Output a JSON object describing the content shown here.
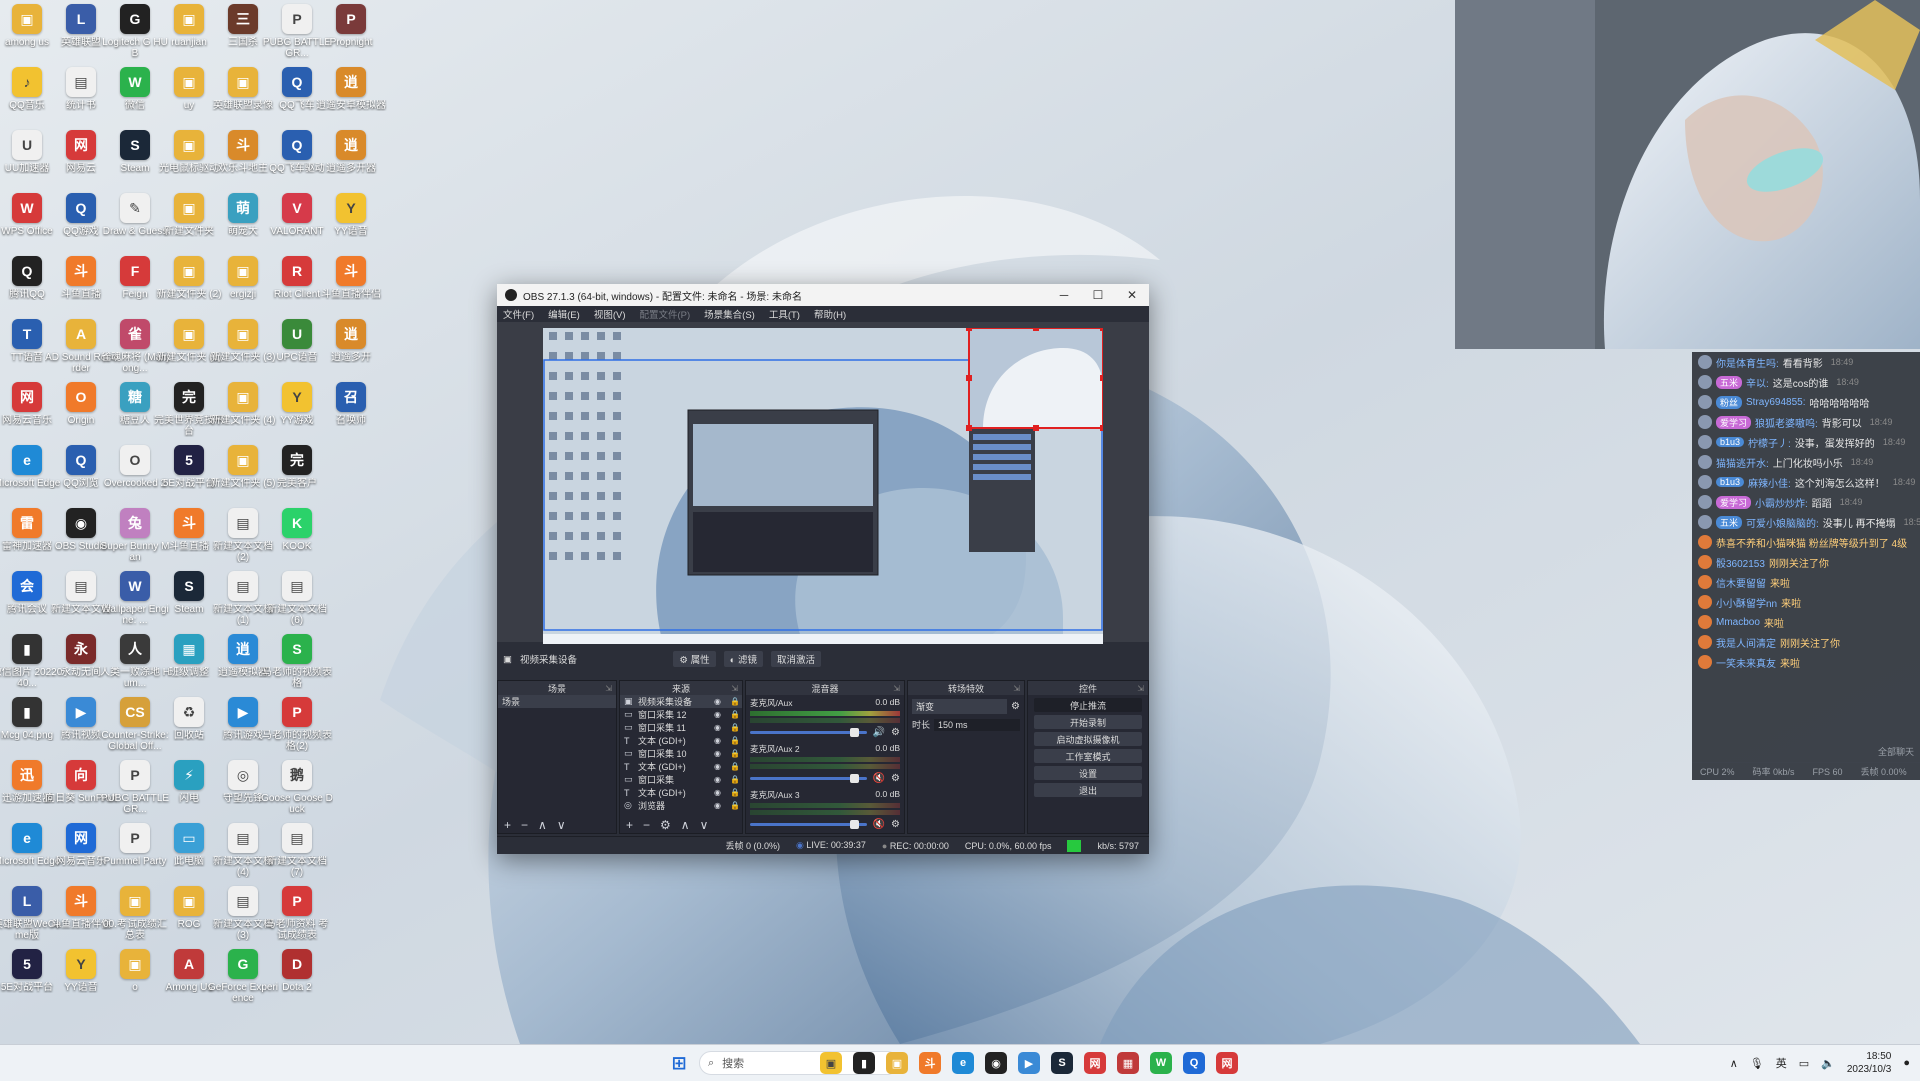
{
  "desktop": {
    "icons": [
      {
        "label": "among us",
        "color": "#e8b33a",
        "glyph": "▣"
      },
      {
        "label": "英雄联盟",
        "color": "#3a5da8",
        "glyph": "L"
      },
      {
        "label": "Logitech G HUB",
        "color": "#222222",
        "glyph": "G"
      },
      {
        "label": "ruanjian",
        "color": "#e8b33a",
        "glyph": "▣"
      },
      {
        "label": "三国杀",
        "color": "#6b3a2a",
        "glyph": "三"
      },
      {
        "label": "PUBG BATTLEGR...",
        "color": "#f0f0f0",
        "glyph": "P"
      },
      {
        "label": "Propnight",
        "color": "#7a3a3a",
        "glyph": "P"
      },
      {
        "label": "QQ音乐",
        "color": "#f2c230",
        "glyph": "♪"
      },
      {
        "label": "统计书",
        "color": "#f0f0f0",
        "glyph": "▤"
      },
      {
        "label": "微信",
        "color": "#2bb24c",
        "glyph": "W"
      },
      {
        "label": "uy",
        "color": "#e8b33a",
        "glyph": "▣"
      },
      {
        "label": "英雄联盟录像",
        "color": "#e8b33a",
        "glyph": "▣"
      },
      {
        "label": "QQ飞车",
        "color": "#2a5fb0",
        "glyph": "Q"
      },
      {
        "label": "逍遥安卓模拟器",
        "color": "#d98a2a",
        "glyph": "逍"
      },
      {
        "label": "UU加速器",
        "color": "#f0f0f0",
        "glyph": "U"
      },
      {
        "label": "网易云",
        "color": "#d63a3a",
        "glyph": "网"
      },
      {
        "label": "Steam",
        "color": "#1b2838",
        "glyph": "S"
      },
      {
        "label": "光电鼠标驱动",
        "color": "#e8b33a",
        "glyph": "▣"
      },
      {
        "label": "欢乐斗地主",
        "color": "#d98a2a",
        "glyph": "斗"
      },
      {
        "label": "QQ飞车驱动",
        "color": "#2a5fb0",
        "glyph": "Q"
      },
      {
        "label": "逍遥多开器",
        "color": "#d98a2a",
        "glyph": "逍"
      },
      {
        "label": "WPS Office",
        "color": "#d63a3a",
        "glyph": "W"
      },
      {
        "label": "QQ游戏",
        "color": "#2a5fb0",
        "glyph": "Q"
      },
      {
        "label": "Draw & Guess",
        "color": "#f0f0f0",
        "glyph": "✎"
      },
      {
        "label": "新建文件夹",
        "color": "#e8b33a",
        "glyph": "▣"
      },
      {
        "label": "萌宠大",
        "color": "#3aa0c0",
        "glyph": "萌"
      },
      {
        "label": "VALORANT",
        "color": "#d63a4a",
        "glyph": "V"
      },
      {
        "label": "YY语音",
        "color": "#f2c230",
        "glyph": "Y"
      },
      {
        "label": "腾讯QQ",
        "color": "#222222",
        "glyph": "Q"
      },
      {
        "label": "斗鱼直播",
        "color": "#f07a2a",
        "glyph": "斗"
      },
      {
        "label": "Feign",
        "color": "#d63a3a",
        "glyph": "F"
      },
      {
        "label": "新建文件夹 (2)",
        "color": "#e8b33a",
        "glyph": "▣"
      },
      {
        "label": "ergizji",
        "color": "#e8b33a",
        "glyph": "▣"
      },
      {
        "label": "Riot Client",
        "color": "#d63a3a",
        "glyph": "R"
      },
      {
        "label": "斗鱼直播伴侣",
        "color": "#f07a2a",
        "glyph": "斗"
      },
      {
        "label": "TT语音",
        "color": "#2a5fb0",
        "glyph": "T"
      },
      {
        "label": "AD Sound Recorder",
        "color": "#e8b33a",
        "glyph": "A"
      },
      {
        "label": "雀魂麻将 (Mahjong...",
        "color": "#c04a6a",
        "glyph": "雀"
      },
      {
        "label": "新建文件夹 (1)",
        "color": "#e8b33a",
        "glyph": "▣"
      },
      {
        "label": "新建文件夹 (3)",
        "color": "#e8b33a",
        "glyph": "▣"
      },
      {
        "label": "UPC语音",
        "color": "#3a8a3a",
        "glyph": "U"
      },
      {
        "label": "逍遥多开",
        "color": "#d98a2a",
        "glyph": "逍"
      },
      {
        "label": "网易云音乐",
        "color": "#d63a3a",
        "glyph": "网"
      },
      {
        "label": "Origin",
        "color": "#f07a2a",
        "glyph": "O"
      },
      {
        "label": "糖豆人",
        "color": "#3aa0c0",
        "glyph": "糖"
      },
      {
        "label": "完美世界竞技平台",
        "color": "#222222",
        "glyph": "完"
      },
      {
        "label": "新建文件夹 (4)",
        "color": "#e8b33a",
        "glyph": "▣"
      },
      {
        "label": "YY游戏",
        "color": "#f2c230",
        "glyph": "Y"
      },
      {
        "label": "召唤师",
        "color": "#2a5fb0",
        "glyph": "召"
      },
      {
        "label": "Microsoft Edge",
        "color": "#1f8ad6",
        "glyph": "e"
      },
      {
        "label": "QQ浏览",
        "color": "#2a5fb0",
        "glyph": "Q"
      },
      {
        "label": "Overcooked 2",
        "color": "#f0f0f0",
        "glyph": "O"
      },
      {
        "label": "5E对战平台",
        "color": "#222244",
        "glyph": "5"
      },
      {
        "label": "新建文件夹 (5)",
        "color": "#e8b33a",
        "glyph": "▣"
      },
      {
        "label": "完美客户",
        "color": "#222222",
        "glyph": "完"
      },
      {
        "label": "雷神加速器",
        "color": "#f07a2a",
        "glyph": "雷"
      },
      {
        "label": "OBS Studio",
        "color": "#222222",
        "glyph": "◉"
      },
      {
        "label": "Super Bunny Man",
        "color": "#c080c0",
        "glyph": "兔"
      },
      {
        "label": "斗鱼直播",
        "color": "#f07a2a",
        "glyph": "斗"
      },
      {
        "label": "新建文本文档 (2)",
        "color": "#f0f0f0",
        "glyph": "▤"
      },
      {
        "label": "KOOK",
        "color": "#2bd26a",
        "glyph": "K"
      },
      {
        "label": "腾讯会议",
        "color": "#1f6ad6",
        "glyph": "会"
      },
      {
        "label": "新建文本文档",
        "color": "#f0f0f0",
        "glyph": "▤"
      },
      {
        "label": "Wallpaper Engine: ...",
        "color": "#3a5da8",
        "glyph": "W"
      },
      {
        "label": "Steam",
        "color": "#1b2838",
        "glyph": "S"
      },
      {
        "label": "新建文本文档 (1)",
        "color": "#f0f0f0",
        "glyph": "▤"
      },
      {
        "label": "新建文本文档 (6)",
        "color": "#f0f0f0",
        "glyph": "▤"
      },
      {
        "label": "微信图片 2022040...",
        "color": "#333333",
        "glyph": "▮"
      },
      {
        "label": "永劫无间",
        "color": "#7a2a2a",
        "glyph": "永"
      },
      {
        "label": "人类一败涂地 Hum...",
        "color": "#3a3a3a",
        "glyph": "人"
      },
      {
        "label": "班级调整",
        "color": "#2aa0c0",
        "glyph": "▦"
      },
      {
        "label": "逍遥模拟器",
        "color": "#2a8ad6",
        "glyph": "逍"
      },
      {
        "label": "马老师的视频表格",
        "color": "#2bb24c",
        "glyph": "S"
      },
      {
        "label": "Mcg 04.png",
        "color": "#333333",
        "glyph": "▮"
      },
      {
        "label": "腾讯视频",
        "color": "#3a8ad6",
        "glyph": "▶"
      },
      {
        "label": "Counter-Strike: Global Off...",
        "color": "#d6a03a",
        "glyph": "CS"
      },
      {
        "label": "回收站",
        "color": "#f0f0f0",
        "glyph": "♻"
      },
      {
        "label": "腾讯游戏",
        "color": "#2a8ad6",
        "glyph": "▶"
      },
      {
        "label": "马老师的视频表格(2)",
        "color": "#d63a3a",
        "glyph": "P"
      },
      {
        "label": "迅游加速器",
        "color": "#f07a2a",
        "glyph": "迅"
      },
      {
        "label": "向日葵 SunProff",
        "color": "#d63a3a",
        "glyph": "向"
      },
      {
        "label": "PUBG BATTLEGR...",
        "color": "#f0f0f0",
        "glyph": "P"
      },
      {
        "label": "闪电",
        "color": "#2aa0c0",
        "glyph": "⚡"
      },
      {
        "label": "守望先锋",
        "color": "#f0f0f0",
        "glyph": "◎"
      },
      {
        "label": "Goose Goose Duck",
        "color": "#f0f0f0",
        "glyph": "鹅"
      },
      {
        "label": "Microsoft Edge",
        "color": "#1f8ad6",
        "glyph": "e"
      },
      {
        "label": "网易云音乐",
        "color": "#1f6ad6",
        "glyph": "网"
      },
      {
        "label": "Pummel Party",
        "color": "#f0f0f0",
        "glyph": "P"
      },
      {
        "label": "此电脑",
        "color": "#3aa0d6",
        "glyph": "▭"
      },
      {
        "label": "新建文本文档 (4)",
        "color": "#f0f0f0",
        "glyph": "▤"
      },
      {
        "label": "新建文本文档 (7)",
        "color": "#f0f0f0",
        "glyph": "▤"
      },
      {
        "label": "英雄联盟WeGame版",
        "color": "#3a5da8",
        "glyph": "L"
      },
      {
        "label": "斗鱼直播伴侣",
        "color": "#f07a2a",
        "glyph": "斗"
      },
      {
        "label": "00.考试成绩汇总表",
        "color": "#e8b33a",
        "glyph": "▣"
      },
      {
        "label": "ROG",
        "color": "#e8b33a",
        "glyph": "▣"
      },
      {
        "label": "新建文本文档 (3)",
        "color": "#f0f0f0",
        "glyph": "▤"
      },
      {
        "label": "马老师资料 考试成绩表",
        "color": "#d63a3a",
        "glyph": "P"
      },
      {
        "label": "5E对战平台",
        "color": "#222244",
        "glyph": "5"
      },
      {
        "label": "YY语音",
        "color": "#f2c230",
        "glyph": "Y"
      },
      {
        "label": "o",
        "color": "#e8b33a",
        "glyph": "▣"
      },
      {
        "label": "Among Us",
        "color": "#c03a3a",
        "glyph": "A"
      },
      {
        "label": "GeForce Experience",
        "color": "#2bb24c",
        "glyph": "G"
      },
      {
        "label": "Dota 2",
        "color": "#b03030",
        "glyph": "D"
      }
    ]
  },
  "chat": {
    "messages": [
      {
        "badge": "",
        "user": "你是体育生吗:",
        "text": "看看背影",
        "time": "18:49"
      },
      {
        "badge": "五米",
        "user": "辛以:",
        "text": "这是cos的谁",
        "time": "18:49"
      },
      {
        "badge": "粉丝",
        "user": "Stray694855:",
        "text": "哈哈哈哈哈哈",
        "time": ""
      },
      {
        "badge": "爱学习",
        "user": "狼狐老婆嗷呜:",
        "text": "背影可以",
        "time": "18:49"
      },
      {
        "badge": "b1u3",
        "user": "柠檬子丿:",
        "text": "没事，蛋发挥好的",
        "time": "18:49"
      },
      {
        "badge": "",
        "user": "猫猫逃开水:",
        "text": "上门化妆吗小乐",
        "time": "18:49"
      },
      {
        "badge": "b1u3",
        "user": "麻辣小佳:",
        "text": "这个刘海怎么这样！",
        "time": "18:49"
      },
      {
        "badge": "爱学习",
        "user": "小霸炒炒炸:",
        "text": "蹈蹈",
        "time": "18:49"
      },
      {
        "badge": "五米",
        "user": "可爱小娘脑脑的:",
        "text": "没事儿 再不掩塌",
        "time": "18:50"
      },
      {
        "badge": "",
        "user": "",
        "text": "恭喜不养和小猫咪猫 粉丝牌等级升到了 4级",
        "time": "",
        "gift": true
      },
      {
        "badge": "",
        "user": "骰3602153",
        "text": "刚刚关注了你",
        "time": "",
        "gift": true
      },
      {
        "badge": "",
        "user": "信木要留留",
        "text": "来啦",
        "time": "",
        "gift": true
      },
      {
        "badge": "",
        "user": "小小酥留学nn",
        "text": "来啦",
        "time": "",
        "gift": true
      },
      {
        "badge": "",
        "user": "Mmacboo",
        "text": "来啦",
        "time": "",
        "gift": true
      },
      {
        "badge": "",
        "user": "我是人间清定",
        "text": "刚刚关注了你",
        "time": "",
        "gift": true
      },
      {
        "badge": "",
        "user": "一笑未来真友",
        "text": "来啦",
        "time": "",
        "gift": true
      }
    ],
    "status": {
      "cpu": "CPU 2%",
      "bitrate": "码率 0kb/s",
      "fps": "FPS 60",
      "drop": "丢帧 0.00%"
    },
    "more": "全部聊天"
  },
  "obs": {
    "title": "OBS 27.1.3 (64-bit, windows) - 配置文件: 未命名 - 场景: 未命名",
    "menu": [
      {
        "label": "文件(F)",
        "disabled": false
      },
      {
        "label": "编辑(E)",
        "disabled": false
      },
      {
        "label": "视图(V)",
        "disabled": false
      },
      {
        "label": "配置文件(P)",
        "disabled": true
      },
      {
        "label": "场景集合(S)",
        "disabled": false
      },
      {
        "label": "工具(T)",
        "disabled": false
      },
      {
        "label": "帮助(H)",
        "disabled": false
      }
    ],
    "toolbar": {
      "source_name": "视频采集设备",
      "properties": "属性",
      "filters": "滤镜",
      "deactivate": "取消激活"
    },
    "docks": {
      "scenes": {
        "title": "场景",
        "items": [
          "场景"
        ]
      },
      "sources": {
        "title": "来源",
        "items": [
          {
            "name": "视频采集设备",
            "icon": "▣"
          },
          {
            "name": "窗口采集 12",
            "icon": "▭"
          },
          {
            "name": "窗口采集 11",
            "icon": "▭"
          },
          {
            "name": "文本 (GDI+)",
            "icon": "T"
          },
          {
            "name": "窗口采集 10",
            "icon": "▭"
          },
          {
            "name": "文本 (GDI+)",
            "icon": "T"
          },
          {
            "name": "窗口采集",
            "icon": "▭"
          },
          {
            "name": "文本 (GDI+)",
            "icon": "T"
          },
          {
            "name": "浏览器",
            "icon": "◎"
          }
        ]
      },
      "mixer": {
        "title": "混音器",
        "channels": [
          {
            "name": "麦克风/Aux",
            "db": "0.0 dB",
            "muted": false
          },
          {
            "name": "麦克风/Aux 2",
            "db": "0.0 dB",
            "muted": true
          },
          {
            "name": "麦克风/Aux 3",
            "db": "0.0 dB",
            "muted": true
          }
        ]
      },
      "transitions": {
        "title": "转场特效",
        "type": "渐变",
        "duration_label": "时长",
        "duration": "150 ms"
      },
      "controls": {
        "title": "控件",
        "buttons": [
          "停止推流",
          "开始录制",
          "启动虚拟摄像机",
          "工作室模式",
          "设置",
          "退出"
        ]
      }
    },
    "status": {
      "dropped": "丢帧 0 (0.0%)",
      "live": "LIVE: 00:39:37",
      "rec": "REC: 00:00:00",
      "cpu": "CPU: 0.0%, 60.00 fps",
      "kbps": "kb/s: 5797"
    }
  },
  "taskbar": {
    "search_placeholder": "搜索",
    "icons": [
      {
        "name": "file-explorer",
        "color": "#f2c230",
        "glyph": "▣"
      },
      {
        "name": "app-1",
        "color": "#222222",
        "glyph": "▮"
      },
      {
        "name": "app-2",
        "color": "#e8b33a",
        "glyph": "▣"
      },
      {
        "name": "app-3",
        "color": "#f07a2a",
        "glyph": "斗"
      },
      {
        "name": "edge",
        "color": "#1f8ad6",
        "glyph": "e"
      },
      {
        "name": "obs",
        "color": "#222222",
        "glyph": "◉"
      },
      {
        "name": "app-4",
        "color": "#3a8ad6",
        "glyph": "▶"
      },
      {
        "name": "steam",
        "color": "#1b2838",
        "glyph": "S"
      },
      {
        "name": "app-5",
        "color": "#d63a3a",
        "glyph": "网"
      },
      {
        "name": "app-6",
        "color": "#c03a3a",
        "glyph": "▦"
      },
      {
        "name": "wechat",
        "color": "#2bb24c",
        "glyph": "W"
      },
      {
        "name": "search-2",
        "color": "#1f6ad6",
        "glyph": "Q"
      },
      {
        "name": "netease",
        "color": "#d63a3a",
        "glyph": "网"
      }
    ],
    "tray": {
      "lang": "英",
      "time": "18:50",
      "date": "2023/10/3"
    }
  }
}
